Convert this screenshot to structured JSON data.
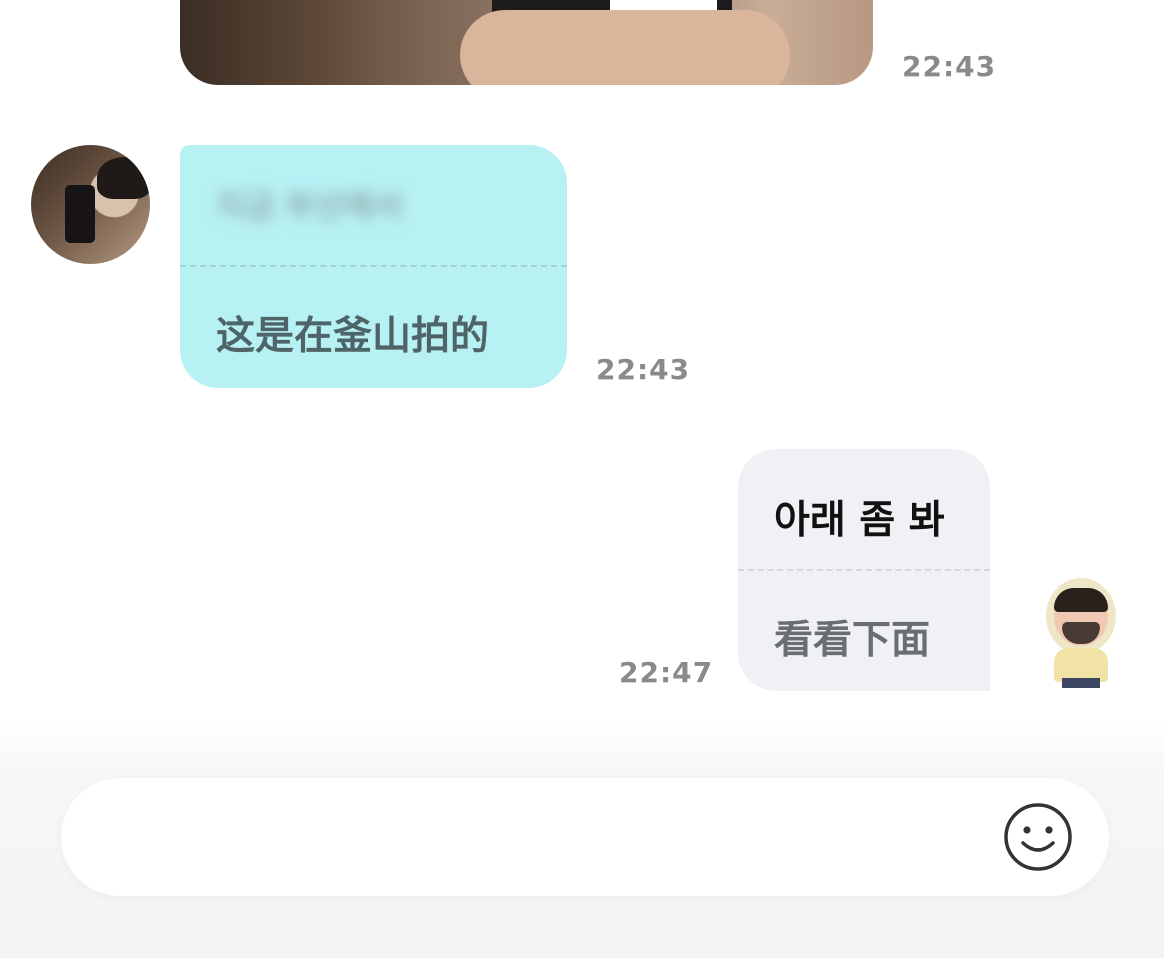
{
  "messages": [
    {
      "id": "image",
      "type": "image",
      "time": "22:43"
    },
    {
      "id": "received",
      "original": "지금 부산에서",
      "translation": "这是在釜山拍的",
      "time": "22:43"
    },
    {
      "id": "sent",
      "original": "아래 좀 봐",
      "translation": "看看下面",
      "time": "22:47"
    }
  ],
  "input": {
    "placeholder": "",
    "emoji_icon": "smiley-icon"
  },
  "colors": {
    "received_bubble": "#b7f1f4",
    "sent_bubble": "#f0f1f5",
    "timestamp": "#8a8a8a"
  }
}
